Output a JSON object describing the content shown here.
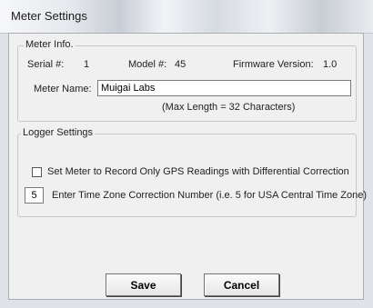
{
  "window": {
    "title": "Meter Settings"
  },
  "meter_info": {
    "legend": "Meter Info.",
    "serial_label": "Serial #:",
    "serial_value": "1",
    "model_label": "Model #:",
    "model_value": "45",
    "firmware_label": "Firmware Version:",
    "firmware_value": "1.0",
    "name_label": "Meter Name:",
    "name_value": "Muigai Labs",
    "max_length_note": "(Max Length = 32 Characters)"
  },
  "logger_settings": {
    "legend": "Logger Settings",
    "gps_checkbox_label": "Set Meter to Record Only GPS Readings with Differential Correction",
    "gps_checkbox_checked": false,
    "timezone_value": "5",
    "timezone_label": "Enter Time Zone Correction Number (i.e. 5 for USA Central Time Zone)"
  },
  "buttons": {
    "save": "Save",
    "cancel": "Cancel"
  }
}
